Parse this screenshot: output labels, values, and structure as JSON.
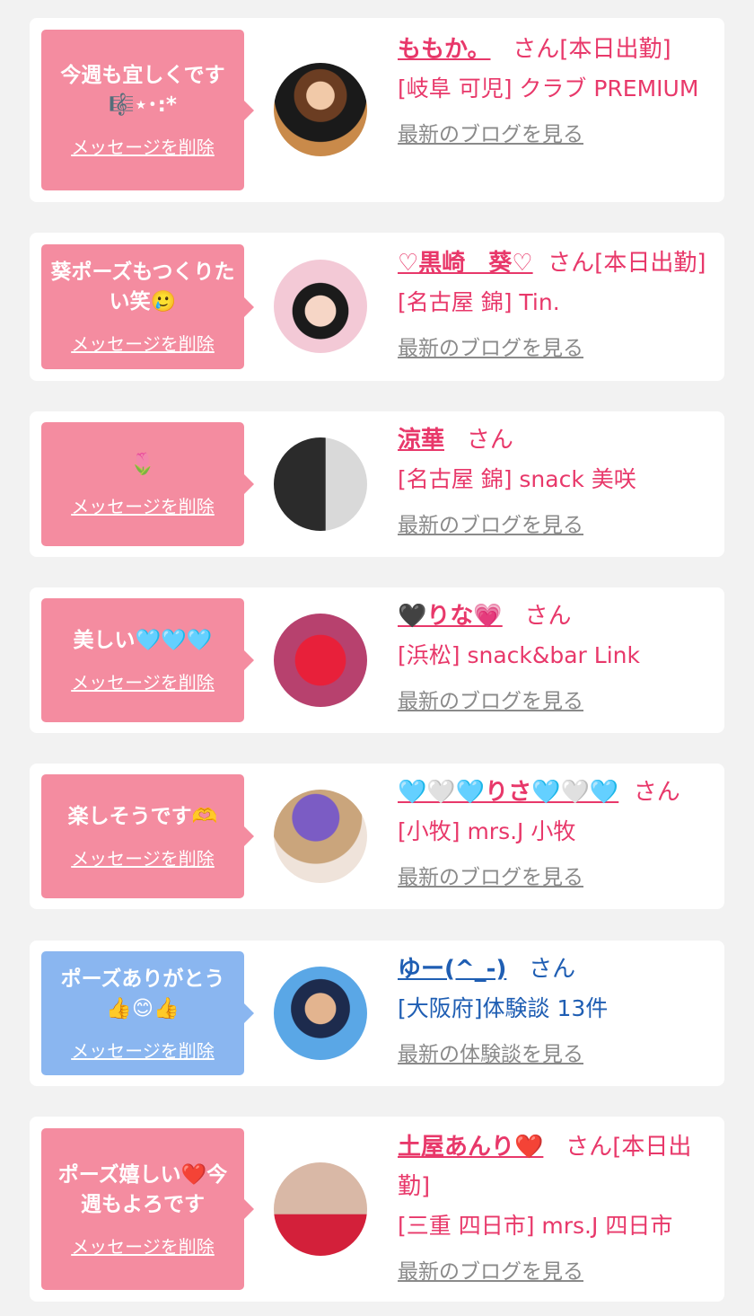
{
  "delete_label": "メッセージを削除",
  "san": "さん",
  "colors": {
    "pink_bubble": "#f48ca0",
    "blue_bubble": "#8ab6f0",
    "name_pink": "#e8386a",
    "name_blue": "#1f5eb3",
    "link_gray": "#8a8a8a",
    "background": "#f2f2f2"
  },
  "items": [
    {
      "message": "今週も宜しくです🎼⋆･:*",
      "name": "ももか。",
      "status": "[本日出勤]",
      "shop": "[岐阜 可児] クラブ PREMIUM",
      "link": "最新のブログを見る",
      "avatar_icon": "woman-black-dress-photo"
    },
    {
      "message": "葵ポーズもつくりたい笑🥲",
      "name": "♡黒崎　葵♡",
      "status": "[本日出勤]",
      "shop": "[名古屋 錦] Tin.",
      "link": "最新のブログを見る",
      "avatar_icon": "woman-cherry-blossom-photo"
    },
    {
      "message": "🌷",
      "name": "涼華",
      "status": "",
      "shop": "[名古屋 錦] snack 美咲",
      "link": "最新のブログを見る",
      "avatar_icon": "woman-hidden-face-photo"
    },
    {
      "message": "美しい🩵🩵🩵",
      "name": "🖤りな💗",
      "status": "",
      "shop": "[浜松] snack&bar Link",
      "link": "最新のブログを見る",
      "avatar_icon": "red-heart-sticker-photo"
    },
    {
      "message": "楽しそうです🫶",
      "name": "🩵🤍🩵りさ🩵🤍🩵",
      "status": "",
      "shop": "[小牧] mrs.J 小牧",
      "link": "最新のブログを見る",
      "avatar_icon": "woman-purple-hat-photo"
    },
    {
      "message": "ポーズありがとう👍😊👍",
      "name": "ゆー(^_-)",
      "status": "",
      "shop": "[大阪府]体験談 13件",
      "link": "最新の体験談を見る",
      "avatar_icon": "man-avatar-thumbs-up"
    },
    {
      "message": "ポーズ嬉しい❤️今週もよろです",
      "name": "土屋あんり❤️",
      "status": "[本日出勤]",
      "shop": "[三重 四日市] mrs.J 四日市",
      "link": "最新のブログを見る",
      "avatar_icon": "woman-eyes-closeup-photo"
    }
  ]
}
